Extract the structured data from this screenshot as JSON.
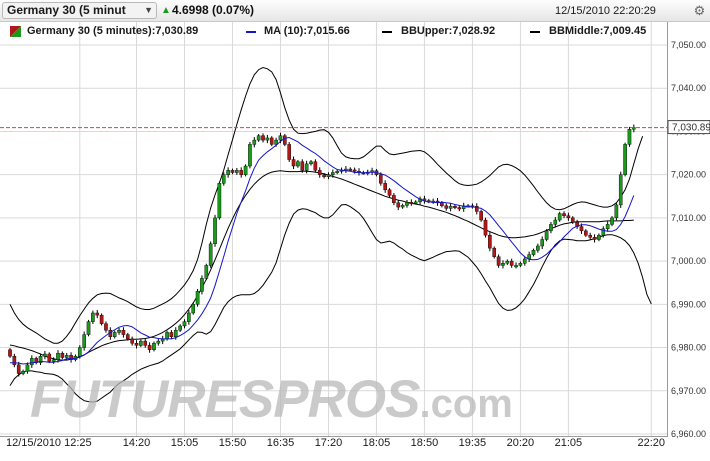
{
  "header": {
    "instrument": "Germany 30 (5 minut",
    "dropdown_icon": "chevron-down-icon",
    "change_icon": "triangle-up-icon",
    "change": "4.6998 (0.07%)",
    "datetime": "12/15/2010 22:20:29",
    "settings_icon": "gear-icon"
  },
  "legend": {
    "icon": "candlestick-icon",
    "main": "Germany 30 (5 minutes):7,030.89",
    "ma": "MA (10):7,015.66",
    "bbupper": "BBUpper:7,028.92",
    "bbmiddle": "BBMiddle:7,009.45"
  },
  "watermark": {
    "text": "FUTURESPROS",
    "suffix": ".com"
  },
  "colors": {
    "up": "#1a9a1a",
    "down": "#b01818",
    "ma": "#1515cc",
    "bands": "#000000",
    "grid": "#d9d9d9",
    "price_line": "#d84040"
  },
  "chart_data": {
    "type": "candlestick",
    "title": "Germany 30 (5 minutes)",
    "ylim": [
      6960,
      7050
    ],
    "yticks": [
      6960,
      6970,
      6980,
      6990,
      7000,
      7010,
      7020,
      7030,
      7040,
      7050
    ],
    "ytick_labels": [
      "6,960.00",
      "6,970.00",
      "6,980.00",
      "6,990.00",
      "7,000.00",
      "7,010.00",
      "7,020.00",
      "7,030.00",
      "7,040.00",
      "7,050.00"
    ],
    "xtick_labels": [
      "12/15/2010 12:25",
      "14:20",
      "15:05",
      "15:50",
      "16:35",
      "17:20",
      "18:05",
      "18:50",
      "19:35",
      "20:20",
      "21:05",
      "22:20"
    ],
    "xtick_index": [
      16,
      29,
      40,
      51,
      62,
      73,
      84,
      95,
      106,
      117,
      128,
      147
    ],
    "n_bars": 150,
    "last_price": 7030.89,
    "last_price_label": "7,030.89",
    "series": [
      {
        "name": "Germany 30 (5 minutes)",
        "kind": "ohlc",
        "close": [
          6978.0,
          6976.0,
          6974.0,
          6974.5,
          6976.0,
          6977.5,
          6976.5,
          6978.0,
          6978.5,
          6976.8,
          6977.2,
          6978.7,
          6977.7,
          6978.2,
          6977.2,
          6978.0,
          6980.0,
          6983.0,
          6986.0,
          6988.0,
          6987.5,
          6985.5,
          6984.0,
          6982.5,
          6983.5,
          6984.0,
          6983.0,
          6982.0,
          6981.0,
          6980.5,
          6981.5,
          6980.5,
          6979.5,
          6981.0,
          6981.5,
          6982.0,
          6983.5,
          6982.5,
          6984.0,
          6985.0,
          6986.0,
          6988.0,
          6990.0,
          6993.0,
          6996.0,
          6999.0,
          7004.0,
          7010.0,
          7018.0,
          7020.0,
          7021.0,
          7020.5,
          7021.0,
          7020.0,
          7022.0,
          7027.0,
          7028.0,
          7029.0,
          7028.0,
          7028.5,
          7027.0,
          7028.0,
          7029.0,
          7027.0,
          7023.5,
          7022.0,
          7023.0,
          7021.0,
          7022.5,
          7023.0,
          7021.0,
          7020.0,
          7019.5,
          7020.0,
          7020.5,
          7020.8,
          7021.1,
          7021.3,
          7021.1,
          7020.8,
          7020.5,
          7020.4,
          7020.6,
          7020.9,
          7020.0,
          7018.0,
          7016.5,
          7015.2,
          7013.5,
          7012.5,
          7012.9,
          7013.6,
          7013.5,
          7013.7,
          7014.4,
          7014.0,
          7013.8,
          7013.9,
          7013.5,
          7012.8,
          7012.2,
          7012.7,
          7012.4,
          7012.1,
          7012.8,
          7012.8,
          7012.7,
          7011.5,
          7009.5,
          7006.0,
          7003.0,
          7001.0,
          6999.0,
          6999.5,
          7000.0,
          6999.0,
          6999.0,
          6999.5,
          7000.5,
          7001.5,
          7002.5,
          7003.5,
          7005.0,
          7007.0,
          7008.5,
          7009.5,
          7011.0,
          7010.5,
          7010.0,
          7009.0,
          7008.0,
          7007.0,
          7006.0,
          7005.5,
          7005.0,
          7006.0,
          7007.5,
          7008.5,
          7010.0,
          7013.0,
          7020.0,
          7027.0,
          7030.5,
          7030.9
        ]
      },
      {
        "name": "MA (10)",
        "kind": "line",
        "values": [
          6976.5,
          6976.5,
          6976.4,
          6976.2,
          6976.3,
          6976.5,
          6976.6,
          6976.8,
          6976.7,
          6976.6,
          6976.6,
          6976.8,
          6977.0,
          6977.4,
          6977.5,
          6977.5,
          6977.8,
          6978.3,
          6979.0,
          6980.1,
          6981.2,
          6982.0,
          6982.8,
          6983.5,
          6984.1,
          6984.7,
          6985.0,
          6985.1,
          6984.8,
          6984.1,
          6983.4,
          6982.9,
          6982.4,
          6982.3,
          6982.1,
          6982.0,
          6982.0,
          6982.0,
          6982.3,
          6982.8,
          6983.4,
          6984.1,
          6985.2,
          6986.4,
          6987.8,
          6989.5,
          6991.5,
          6994.3,
          6997.7,
          7001.1,
          7004.6,
          7007.8,
          7011.0,
          7013.7,
          7016.3,
          7019.1,
          7021.5,
          7023.4,
          7024.4,
          7025.3,
          7026.0,
          7026.8,
          7027.7,
          7028.4,
          7028.6,
          7028.1,
          7027.6,
          7026.8,
          7026.2,
          7025.5,
          7024.9,
          7024.1,
          7023.2,
          7022.5,
          7021.8,
          7021.2,
          7021.0,
          7020.9,
          7020.8,
          7020.5,
          7020.5,
          7020.4,
          7020.5,
          7020.6,
          7020.5,
          7020.2,
          7019.9,
          7019.3,
          7018.6,
          7017.8,
          7017.0,
          7016.3,
          7015.6,
          7014.9,
          7014.3,
          7013.9,
          7013.7,
          7013.6,
          7013.5,
          7013.6,
          7013.5,
          7013.4,
          7013.1,
          7012.9,
          7012.7,
          7012.6,
          7012.6,
          7012.4,
          7012.2,
          7011.6,
          7010.7,
          7009.5,
          7008.2,
          7007.0,
          7005.7,
          7004.4,
          7003.2,
          7001.9,
          7001.0,
          7000.4,
          7000.3,
          7000.4,
          7000.9,
          7001.6,
          7002.6,
          7003.5,
          7004.5,
          7005.6,
          7006.6,
          7007.6,
          7008.1,
          7008.4,
          7008.4,
          7008.2,
          7007.8,
          7007.4,
          7007.1,
          7006.9,
          7006.9,
          7007.3,
          7008.5,
          7010.3,
          7012.7,
          7015.2
        ]
      },
      {
        "name": "BBUpper",
        "kind": "line",
        "values": [
          6990.0,
          6988.0,
          6986.5,
          6985.4,
          6984.6,
          6984.0,
          6983.4,
          6982.7,
          6982.0,
          6981.5,
          6981.0,
          6981.0,
          6981.5,
          6982.6,
          6984.0,
          6985.7,
          6987.4,
          6988.9,
          6990.3,
          6991.4,
          6992.2,
          6992.5,
          6992.6,
          6992.5,
          6992.0,
          6991.5,
          6991.1,
          6990.6,
          6990.0,
          6989.4,
          6989.0,
          6988.8,
          6988.8,
          6989.1,
          6989.6,
          6990.1,
          6990.6,
          6991.3,
          6992.2,
          6993.3,
          6994.5,
          6996.0,
          6997.8,
          7000.4,
          7004.1,
          7008.5,
          7012.3,
          7015.3,
          7018.1,
          7021.1,
          7024.6,
          7028.1,
          7031.6,
          7035.0,
          7038.2,
          7041.0,
          7043.1,
          7044.3,
          7044.8,
          7044.5,
          7043.8,
          7042.0,
          7038.9,
          7035.5,
          7032.6,
          7030.5,
          7029.6,
          7029.5,
          7029.6,
          7029.8,
          7030.0,
          7030.3,
          7030.4,
          7029.8,
          7028.5,
          7026.7,
          7025.0,
          7024.1,
          7023.8,
          7023.7,
          7023.7,
          7024.1,
          7024.9,
          7025.8,
          7026.6,
          7026.6,
          7025.6,
          7024.8,
          7024.6,
          7024.8,
          7025.0,
          7025.2,
          7025.4,
          7025.5,
          7025.6,
          7025.3,
          7024.5,
          7023.5,
          7022.4,
          7021.4,
          7020.4,
          7019.5,
          7018.6,
          7017.9,
          7017.6,
          7017.5,
          7017.6,
          7017.8,
          7018.3,
          7019.0,
          7019.8,
          7020.8,
          7021.8,
          7022.3,
          7022.4,
          7022.1,
          7021.6,
          7020.9,
          7019.9,
          7018.7,
          7017.4,
          7016.0,
          7014.7,
          7013.5,
          7012.6,
          7012.0,
          7011.9,
          7012.1,
          7012.6,
          7013.1,
          7013.5,
          7013.7,
          7013.6,
          7013.3,
          7013.0,
          7012.7,
          7012.5,
          7012.5,
          7012.8,
          7013.5,
          7014.8,
          7016.5,
          7019.0,
          7022.5,
          7026.0,
          7028.9
        ]
      },
      {
        "name": "BBMiddle",
        "kind": "line",
        "values": [
          6980.6,
          6980.4,
          6980.1,
          6979.9,
          6979.6,
          6979.3,
          6978.9,
          6978.5,
          6978.0,
          6977.7,
          6977.4,
          6977.2,
          6977.1,
          6977.1,
          6977.3,
          6977.5,
          6977.9,
          6978.3,
          6978.9,
          6979.4,
          6979.9,
          6980.4,
          6980.8,
          6981.1,
          6981.4,
          6981.6,
          6981.7,
          6981.8,
          6981.9,
          6981.9,
          6982.0,
          6982.1,
          6982.3,
          6982.6,
          6983.0,
          6983.5,
          6984.1,
          6984.8,
          6985.6,
          6986.5,
          6987.6,
          6988.9,
          6990.3,
          6992.0,
          6993.8,
          6995.8,
          6998.0,
          7000.3,
          7002.7,
          7005.2,
          7007.6,
          7009.8,
          7011.8,
          7013.6,
          7015.2,
          7016.6,
          7017.8,
          7018.8,
          7019.6,
          7020.2,
          7020.6,
          7020.8,
          7020.9,
          7020.8,
          7020.7,
          7020.7,
          7020.7,
          7020.8,
          7020.8,
          7020.7,
          7020.6,
          7020.4,
          7020.2,
          7019.9,
          7019.6,
          7019.3,
          7019.0,
          7018.6,
          7018.2,
          7017.8,
          7017.4,
          7017.0,
          7016.6,
          7016.2,
          7015.8,
          7015.4,
          7015.0,
          7014.7,
          7014.4,
          7014.1,
          7013.9,
          7013.6,
          7013.4,
          7013.2,
          7013.0,
          7012.7,
          7012.5,
          7012.2,
          7011.9,
          7011.6,
          7011.3,
          7010.9,
          7010.5,
          7010.1,
          7009.6,
          7009.2,
          7008.7,
          7008.2,
          7007.7,
          7007.2,
          7006.8,
          7006.4,
          7006.0,
          7005.7,
          7005.5,
          7005.4,
          7005.4,
          7005.5,
          7005.6,
          7005.8,
          7006.0,
          7006.3,
          7006.7,
          7007.1,
          7007.5,
          7007.9,
          7008.3,
          7008.6,
          7008.8,
          7009.0,
          7009.1,
          7009.1,
          7009.1,
          7009.1,
          7009.1,
          7009.1,
          7009.2,
          7009.3,
          7009.3,
          7009.3,
          7009.3,
          7009.4,
          7009.4,
          7009.5
        ]
      },
      {
        "name": "BBLower",
        "kind": "line",
        "values": [
          6971.2,
          6972.8,
          6973.7,
          6974.4,
          6974.6,
          6974.6,
          6974.4,
          6974.3,
          6974.0,
          6973.9,
          6973.8,
          6973.4,
          6972.7,
          6971.6,
          6970.6,
          6969.3,
          6968.4,
          6967.7,
          6967.5,
          6967.4,
          6967.6,
          6968.3,
          6969.0,
          6969.7,
          6970.8,
          6971.7,
          6972.3,
          6973.0,
          6973.8,
          6974.4,
          6975.0,
          6975.4,
          6975.8,
          6976.1,
          6976.4,
          6976.9,
          6977.6,
          6978.3,
          6979.0,
          6979.7,
          6980.7,
          6981.8,
          6982.8,
          6983.6,
          6983.5,
          6983.1,
          6983.7,
          6985.3,
          6987.3,
          6989.3,
          6990.6,
          6991.5,
          6992.0,
          6992.2,
          6992.2,
          6992.2,
          6992.5,
          6993.3,
          6994.4,
          6995.9,
          6997.4,
          6999.6,
          7002.9,
          7006.1,
          7008.8,
          7010.9,
          7011.8,
          7012.1,
          7012.0,
          7011.6,
          7011.2,
          7010.5,
          7010.0,
          7010.0,
          7010.7,
          7011.9,
          7013.0,
          7013.1,
          7012.6,
          7011.9,
          7011.1,
          7009.9,
          7008.3,
          7006.6,
          7005.0,
          7004.2,
          7004.4,
          7004.6,
          7004.2,
          7003.4,
          7002.8,
          7002.0,
          7001.4,
          7000.9,
          7000.4,
          7000.1,
          7000.5,
          7000.9,
          7001.4,
          7001.8,
          7002.2,
          7002.3,
          7002.4,
          7002.3,
          7001.6,
          7000.9,
          6999.8,
          6998.6,
          6997.1,
          6995.4,
          6993.8,
          6992.0,
          6990.2,
          6989.1,
          6988.6,
          6988.7,
          6989.2,
          6990.1,
          6991.3,
          6992.9,
          6994.6,
          6996.6,
          6998.7,
          7000.7,
          7002.4,
          7003.8,
          7004.7,
          7005.1,
          7005.0,
          7004.9,
          7004.7,
          7004.7,
          7004.7,
          7004.9,
          7005.2,
          7005.5,
          7005.9,
          7006.1,
          7006.1,
          7005.8,
          7005.4,
          7004.7,
          7003.6,
          7001.9,
          6999.5,
          6996.2,
          6992.3,
          6990.1
        ]
      }
    ]
  }
}
